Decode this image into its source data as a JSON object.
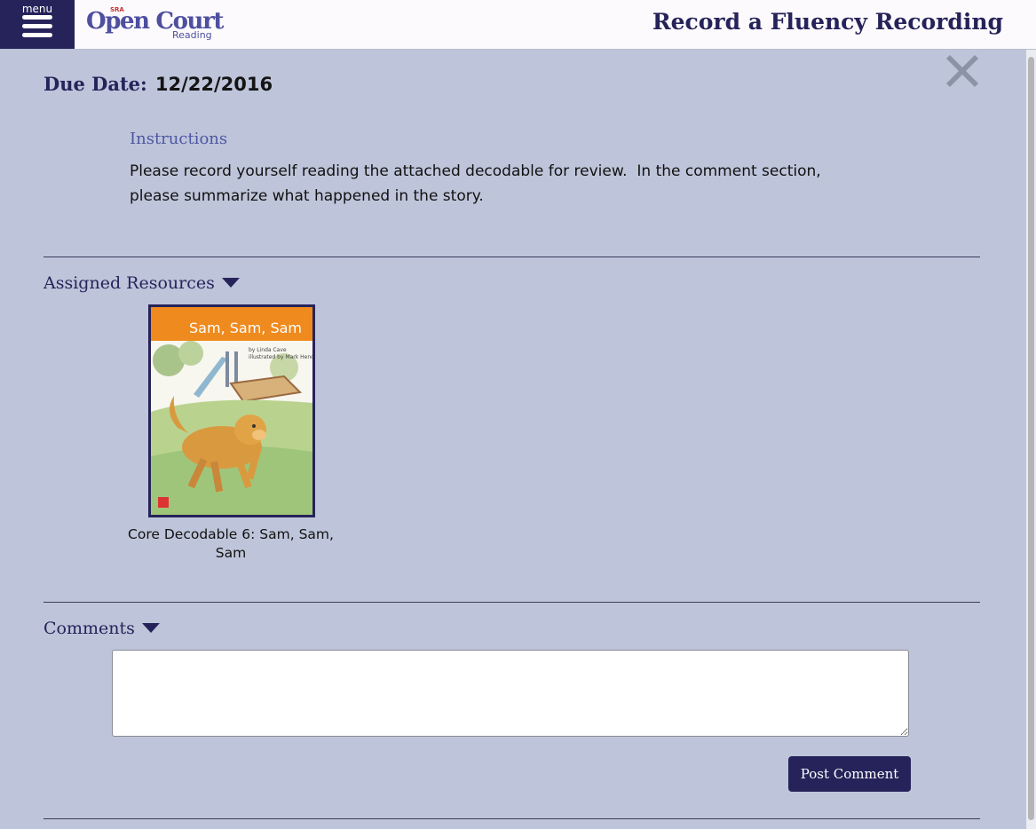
{
  "header": {
    "menu_label": "menu",
    "logo_main": "Open Court",
    "logo_sub": "Reading",
    "logo_mark": "SRA",
    "title": "Record a Fluency Recording"
  },
  "assignment": {
    "due_label": "Due Date:",
    "due_value": "12/22/2016",
    "instructions_title": "Instructions",
    "instructions_text": "Please record yourself reading the attached decodable for review.  In the comment section,\nplease summarize what happened in the story."
  },
  "resources": {
    "section_label": "Assigned Resources",
    "items": [
      {
        "cover_title": "Sam, Sam, Sam",
        "cover_author_line1": "by Linda Cave",
        "cover_author_line2": "illustrated by Mark Henderson",
        "caption": "Core Decodable 6: Sam, Sam, Sam"
      }
    ]
  },
  "comments": {
    "section_label": "Comments",
    "input_value": "",
    "post_label": "Post Comment"
  },
  "colors": {
    "page_bg": "#bec5da",
    "header_bg": "#fcfafc",
    "navy": "#26235a",
    "cover_orange": "#ef8a1e"
  },
  "icons": {
    "menu": "hamburger-icon",
    "close": "close-x-icon",
    "caret": "caret-down-icon"
  }
}
